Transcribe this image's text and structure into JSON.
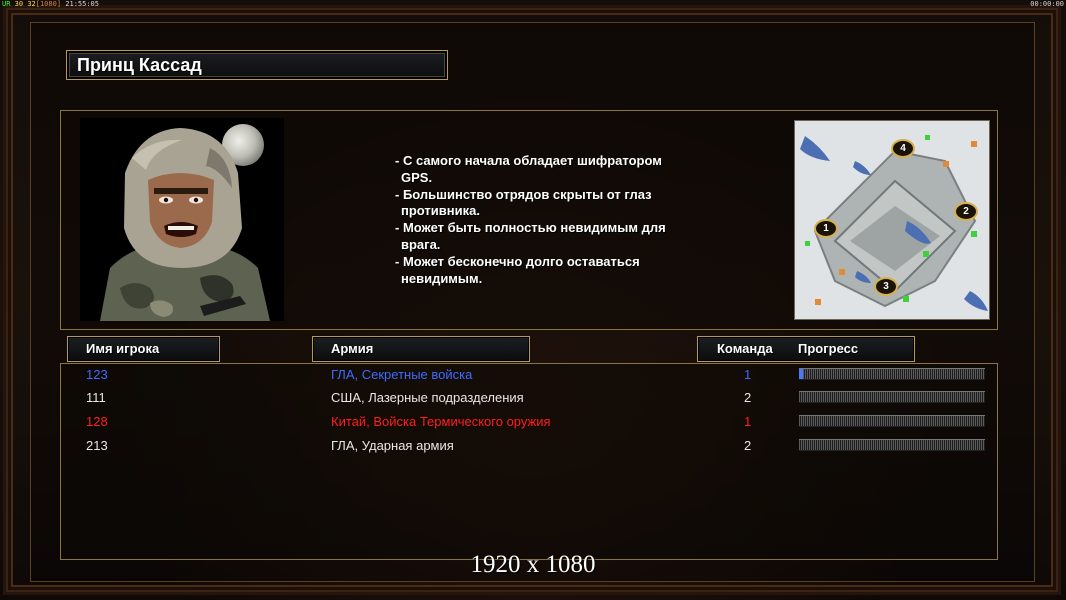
{
  "overlay": {
    "left_prefix": "UR",
    "fps_a": "30",
    "fps_b": "32",
    "resolution_tag": "[1080]",
    "clock": "21:55:05",
    "timer": "00:00:00"
  },
  "general": {
    "name": "Принц Кассад",
    "portrait": "general-portrait",
    "description": [
      "- С самого начала обладает шифратором",
      "  GPS.",
      "- Большинство отрядов скрыты от глаз",
      "  противника.",
      "- Может быть полностью невидимым для",
      "  врага.",
      "- Может бесконечно долго оставаться",
      "  невидимым."
    ]
  },
  "minimap": {
    "start_positions": [
      "1",
      "2",
      "3",
      "4"
    ]
  },
  "table": {
    "headers": {
      "player_name": "Имя игрока",
      "army": "Армия",
      "team": "Команда",
      "progress": "Прогресс"
    },
    "rows": [
      {
        "name": "123",
        "army": "ГЛА, Секретные войска",
        "team": "1",
        "color": "#3f6bff",
        "progress": 0.02
      },
      {
        "name": "111",
        "army": "США, Лазерные подразделения",
        "team": "2",
        "color": "#e8e8e8",
        "progress": 0
      },
      {
        "name": "128",
        "army": "Китай, Войска Термического оружия",
        "team": "1",
        "color": "#ff1e1e",
        "progress": 0
      },
      {
        "name": "213",
        "army": "ГЛА, Ударная армия",
        "team": "2",
        "color": "#e8e8e8",
        "progress": 0
      }
    ]
  },
  "footer": {
    "resolution": "1920 x 1080"
  },
  "colors": {
    "frame_gold": "#b49a55",
    "panel_border": "#8a7440",
    "progress_fill": "#4a78ff"
  }
}
